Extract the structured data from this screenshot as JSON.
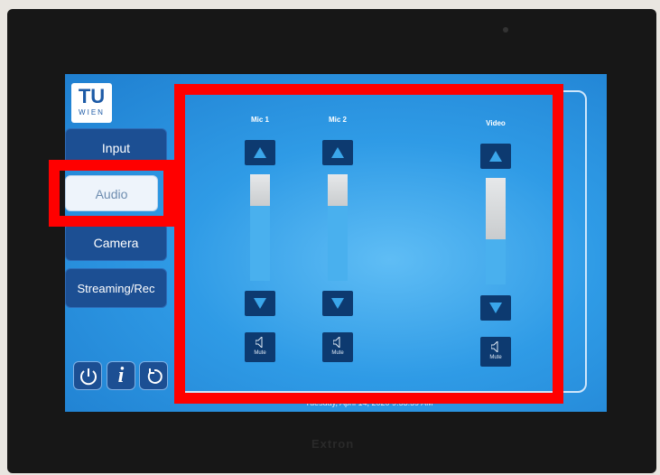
{
  "device": {
    "brand": "Extron"
  },
  "logo": {
    "line1": "TU",
    "line2": "WIEN"
  },
  "nav": [
    {
      "label": "Input",
      "active": false
    },
    {
      "label": "Audio",
      "active": true
    },
    {
      "label": "Camera",
      "active": false
    },
    {
      "label": "Streaming/Rec",
      "active": false
    }
  ],
  "bottom_buttons": [
    "power-icon",
    "info-icon",
    "reset-icon"
  ],
  "info_glyph": "i",
  "footer": {
    "date": "Tuesday, April 14, 2020 9:53:59 AM"
  },
  "channels": [
    {
      "label": "Mic 1",
      "level": 0.3,
      "mute_label": "Mute"
    },
    {
      "label": "Mic 2",
      "level": 0.3,
      "mute_label": "Mute"
    },
    {
      "label": "Video",
      "level": 0.58,
      "mute_label": "Mute"
    }
  ],
  "colors": {
    "highlight": "#ff0000",
    "screen": "#2f9be6",
    "button": "#1c4f93"
  }
}
